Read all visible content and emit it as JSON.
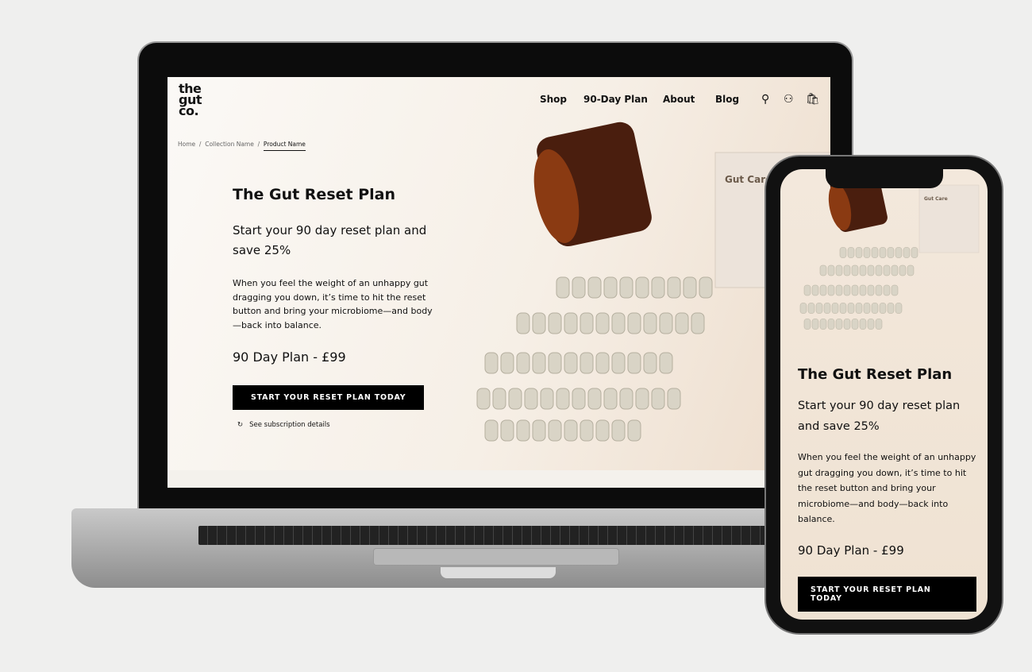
{
  "brand": {
    "logo_lines": [
      "the",
      "gut",
      "co."
    ]
  },
  "nav": {
    "items": [
      "Shop",
      "90-Day Plan",
      "About",
      "Blog"
    ],
    "icons": [
      "search-icon",
      "account-icon",
      "cart-icon"
    ]
  },
  "breadcrumb": [
    "Home",
    "Collection Name",
    "Product Name"
  ],
  "product": {
    "title": "The Gut Reset Plan",
    "subtitle": "Start your 90 day reset plan and save 25%",
    "description": "When you feel the weight of an unhappy gut dragging you down, it’s time to hit the reset button and bring your microbiome—and body—back into balance.",
    "price": "90 Day Plan - £99",
    "cta": "START YOUR RESET PLAN TODAY",
    "subscription_link": "See subscription details",
    "packaging_label": "Gut Care"
  },
  "colors": {
    "button": "#000000",
    "background": "#f6efe6",
    "jar": "#4a1e0e"
  }
}
